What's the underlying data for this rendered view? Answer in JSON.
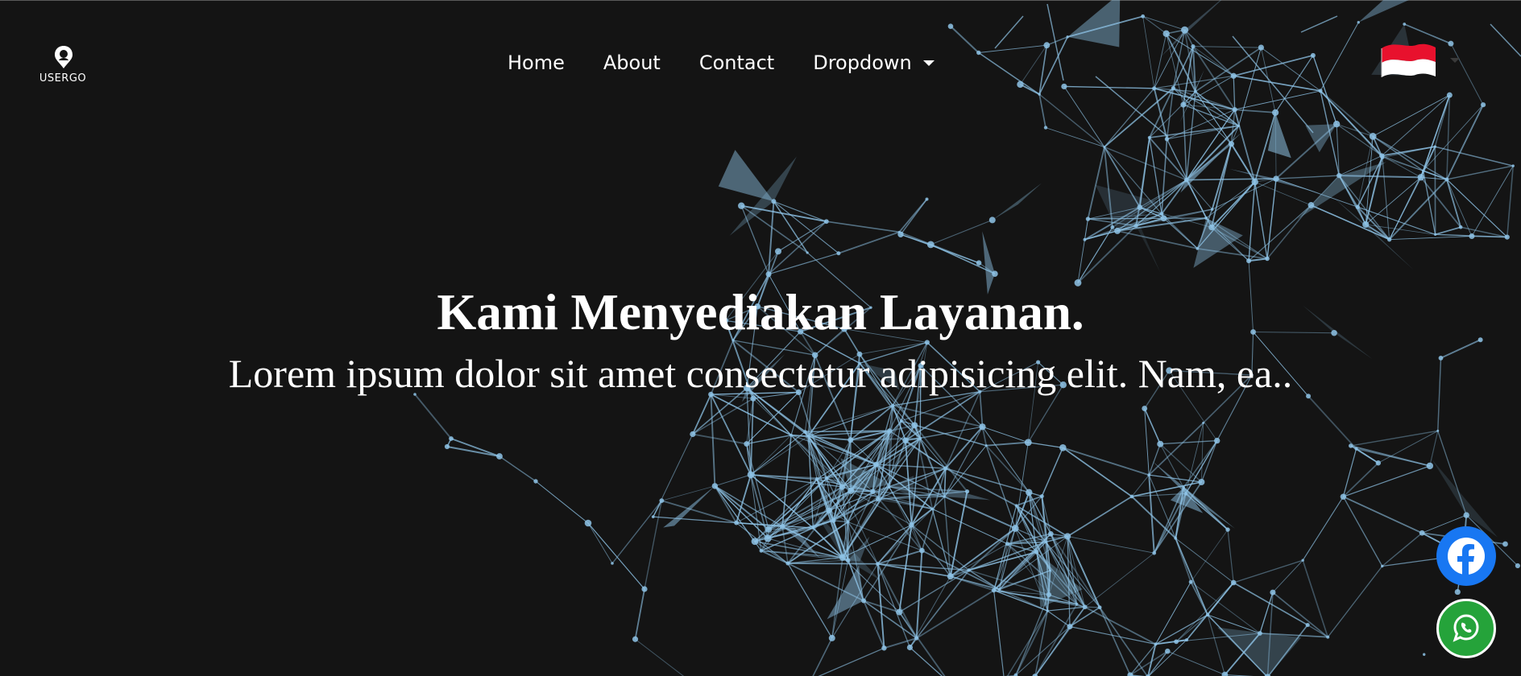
{
  "brand": {
    "logo_text": "USERGO",
    "logo_icon": "map-pin-user-icon"
  },
  "nav": {
    "items": [
      {
        "label": "Home"
      },
      {
        "label": "About"
      },
      {
        "label": "Contact"
      },
      {
        "label": "Dropdown"
      }
    ],
    "dropdown_icon": "caret-down-icon"
  },
  "language": {
    "flag": "indonesia-flag-icon",
    "colors": {
      "red": "#e8112d",
      "white": "#ffffff"
    }
  },
  "hero": {
    "title": "Kami Menyediakan Layanan.",
    "subtitle": "Lorem ipsum dolor sit amet consectetur adipisicing elit. Nam, ea.."
  },
  "social": {
    "facebook": {
      "icon": "facebook-icon",
      "color": "#1877f2"
    },
    "whatsapp": {
      "icon": "whatsapp-icon",
      "color": "#25a33a"
    }
  },
  "theme": {
    "background": "#141414",
    "network_color": "#8ec3e6",
    "text_color": "#ffffff"
  }
}
